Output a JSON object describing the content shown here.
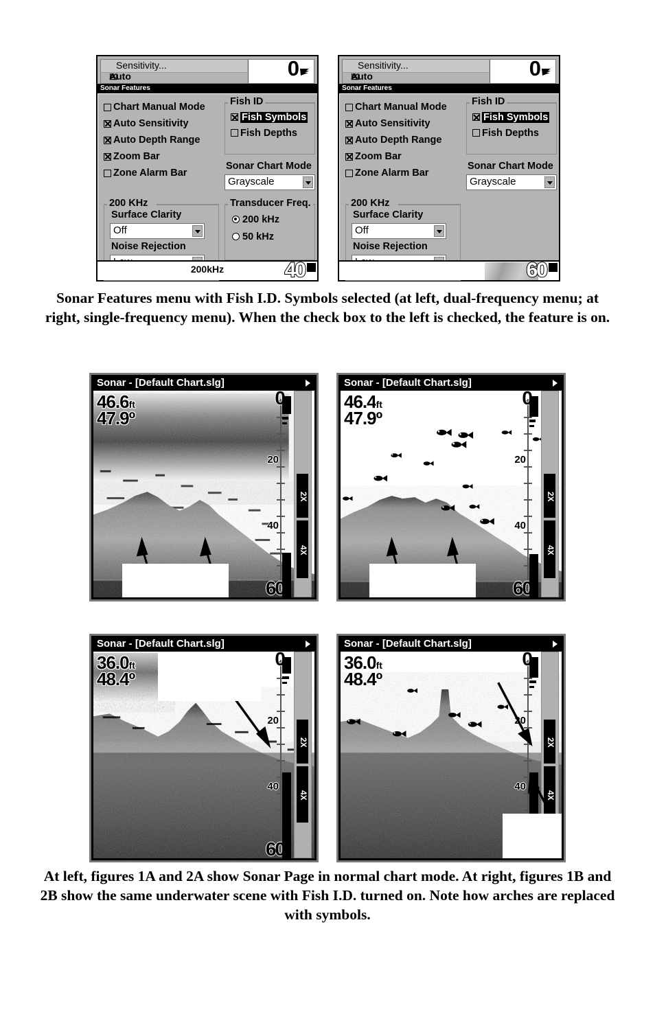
{
  "menus": [
    {
      "id": "dual-frequency",
      "sensitivity": {
        "label": "Sensitivity...",
        "auto_label": "Auto Sensitivity",
        "digital_value": "0"
      },
      "popup_title": "Sonar Features",
      "checkboxes": [
        {
          "label": "Chart Manual Mode",
          "checked": false
        },
        {
          "label": "Auto Sensitivity",
          "checked": true
        },
        {
          "label": "Auto Depth Range",
          "checked": true
        },
        {
          "label": "Zoom Bar",
          "checked": true
        },
        {
          "label": "Zone Alarm Bar",
          "checked": false
        }
      ],
      "fish_id": {
        "group_title": "Fish ID",
        "items": [
          {
            "label": "Fish Symbols",
            "checked": true,
            "highlighted": true
          },
          {
            "label": "Fish Depths",
            "checked": false,
            "highlighted": false
          }
        ]
      },
      "sonar_chart_mode": {
        "label": "Sonar Chart Mode",
        "value": "Grayscale"
      },
      "freq_group": {
        "group_title": "200 KHz",
        "surface_clarity": {
          "label": "Surface Clarity",
          "value": "Off"
        },
        "noise_rejection": {
          "label": "Noise Rejection",
          "value": "Low"
        }
      },
      "transducer": {
        "group_title": "Transducer Freq.",
        "options": [
          {
            "label": "200 kHz",
            "selected": true
          },
          {
            "label": "50 kHz",
            "selected": false
          }
        ]
      },
      "footer": {
        "frequency": "200kHz",
        "depth": "40",
        "has_noise_graphic": false
      }
    },
    {
      "id": "single-frequency",
      "sensitivity": {
        "label": "Sensitivity...",
        "auto_label": "Auto Sensitivity",
        "digital_value": "0"
      },
      "popup_title": "Sonar Features",
      "checkboxes": [
        {
          "label": "Chart Manual Mode",
          "checked": false
        },
        {
          "label": "Auto Sensitivity",
          "checked": true
        },
        {
          "label": "Auto Depth Range",
          "checked": true
        },
        {
          "label": "Zoom Bar",
          "checked": true
        },
        {
          "label": "Zone Alarm Bar",
          "checked": false
        }
      ],
      "fish_id": {
        "group_title": "Fish ID",
        "items": [
          {
            "label": "Fish Symbols",
            "checked": true,
            "highlighted": true
          },
          {
            "label": "Fish Depths",
            "checked": false,
            "highlighted": false
          }
        ]
      },
      "sonar_chart_mode": {
        "label": "Sonar Chart Mode",
        "value": "Grayscale"
      },
      "freq_group": {
        "group_title": "200 KHz",
        "surface_clarity": {
          "label": "Surface Clarity",
          "value": "Off"
        },
        "noise_rejection": {
          "label": "Noise Rejection",
          "value": "Low"
        }
      },
      "transducer": null,
      "footer": {
        "frequency": "",
        "depth": "60",
        "has_noise_graphic": true
      }
    }
  ],
  "captions": {
    "top": "Sonar Features menu with Fish I.D. Symbols selected (at left, dual-frequency menu; at right, single-frequency menu). When the check box to the left is checked, the feature is on.",
    "bottom": "At left, figures 1A and 2A show Sonar Page in normal chart mode. At right, figures 1B and 2B show the same underwater scene with Fish I.D. turned on. Note how arches are replaced with symbols."
  },
  "sonar_screens": [
    {
      "id": "1A",
      "title": "Sonar - [Default Chart.slg]",
      "depth": "46.6",
      "depth_unit": "ft",
      "temperature": "47.9",
      "temperature_unit": "º",
      "scale_labels": [
        "0",
        "20",
        "40",
        "60"
      ],
      "zoom_bar": [
        "2X",
        "4X"
      ],
      "fish_id_on": false,
      "arrow_count": 2
    },
    {
      "id": "1B",
      "title": "Sonar - [Default Chart.slg]",
      "depth": "46.4",
      "depth_unit": "ft",
      "temperature": "47.9",
      "temperature_unit": "º",
      "scale_labels": [
        "0",
        "20",
        "40",
        "60"
      ],
      "zoom_bar": [
        "2X",
        "4X"
      ],
      "fish_id_on": true,
      "arrow_count": 2
    },
    {
      "id": "2A",
      "title": "Sonar - [Default Chart.slg]",
      "depth": "36.0",
      "depth_unit": "ft",
      "temperature": "48.4",
      "temperature_unit": "º",
      "scale_labels": [
        "0",
        "20",
        "40",
        "60"
      ],
      "zoom_bar": [
        "2X",
        "4X"
      ],
      "fish_id_on": false,
      "arrow_count": 1
    },
    {
      "id": "2B",
      "title": "Sonar - [Default Chart.slg]",
      "depth": "36.0",
      "depth_unit": "ft",
      "temperature": "48.4",
      "temperature_unit": "º",
      "scale_labels": [
        "0",
        "20",
        "40"
      ],
      "zoom_bar": [
        "2X",
        "4X"
      ],
      "fish_id_on": true,
      "arrow_count": 2
    }
  ],
  "colors": {
    "menu_background": "#b4b4b4",
    "titlebar": "#000000",
    "titlebar_text": "#ffffff",
    "field_background": "#ffffff",
    "screen_bezel": "#787878"
  }
}
